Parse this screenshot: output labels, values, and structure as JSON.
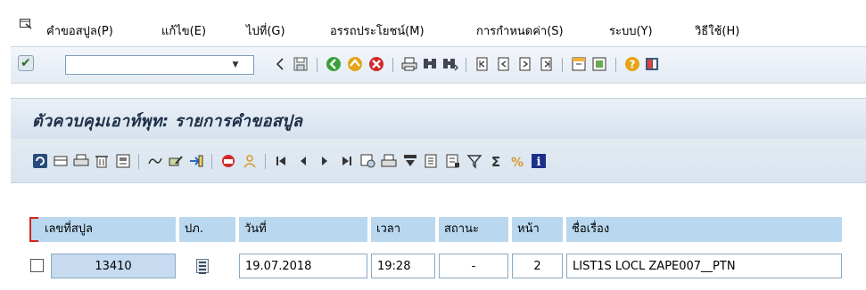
{
  "menubar": {
    "items": [
      {
        "label": "คำขอสปูล(P)"
      },
      {
        "label": "แก้ไข(E)"
      },
      {
        "label": "ไปที่(G)"
      },
      {
        "label": "อรรถประโยชน์(M)"
      },
      {
        "label": "การกำหนดค่า(S)"
      },
      {
        "label": "ระบบ(Y)"
      },
      {
        "label": "วิธีใช้(H)"
      }
    ]
  },
  "toolbar": {
    "command_value": "",
    "icons": [
      "enter-icon",
      "command-dropdown-icon",
      "back-arrow-icon",
      "save-icon",
      "back-icon",
      "exit-icon",
      "cancel-icon",
      "print-icon",
      "find-icon",
      "find-next-icon",
      "first-page-icon",
      "previous-page-icon",
      "next-page-icon",
      "last-page-icon",
      "create-session-icon",
      "shortcut-icon",
      "help-icon",
      "customize-layout-icon"
    ]
  },
  "title": {
    "text": "ตัวควบคุมเอาท์พุท: รายการคำขอสปูล"
  },
  "colors": {
    "header_bg": "#b9d8ef",
    "key_cell_bg": "#c6daf0",
    "title_bg": "#d6e2ee",
    "toolbar_bg": "#e3ebf3",
    "selection_marker": "#d0261d"
  },
  "table": {
    "headers": [
      "เลขที่สปูล",
      "ปภ.",
      "วันที่",
      "เวลา",
      "สถานะ",
      "หน้า",
      "ชื่อเรื่อง"
    ],
    "rows": [
      {
        "spool_no": "13410",
        "type_icon": "list-icon",
        "date": "19.07.2018",
        "time": "19:28",
        "status": "-",
        "pages": "2",
        "title": "LIST1S LOCL ZAPE007__PTN"
      }
    ]
  }
}
